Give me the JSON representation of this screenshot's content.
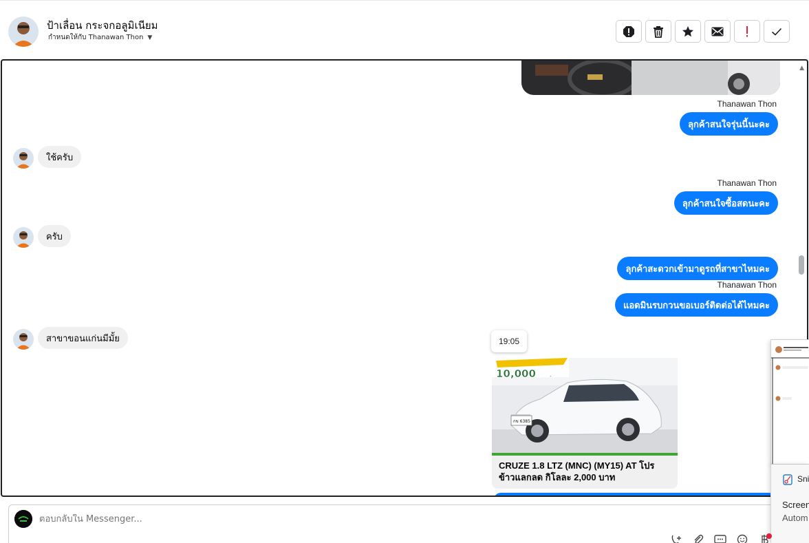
{
  "header": {
    "contact_name": "ป้าเลื่อน กระจกอลูมิเนียม",
    "assigned_label": "กำหนดให้กับ Thanawan Thon",
    "tools": [
      "mark-spam",
      "delete",
      "star",
      "mark-unread",
      "important",
      "done"
    ]
  },
  "conversation": {
    "messages": [
      {
        "type": "outgoing",
        "sender": "Thanawan Thon",
        "text": "ลุกค้าสนใจรุ่นนี้นะคะ"
      },
      {
        "type": "incoming",
        "text": "ใช้ครับ"
      },
      {
        "type": "outgoing",
        "sender": "Thanawan Thon",
        "text": "ลุกค้าสนใจซื้อสดนะคะ"
      },
      {
        "type": "incoming",
        "text": "ครับ"
      },
      {
        "type": "outgoing",
        "text": "ลุกค้าสะดวกเข้ามาดูรถที่สาขาไหมคะ"
      },
      {
        "type": "outgoing",
        "sender": "Thanawan Thon",
        "text": "แอดมินรบกวนขอเบอร์ติดต่อได้ไหมคะ"
      },
      {
        "type": "incoming",
        "text": "สาขาขอนแก่นมีมั้ย"
      }
    ],
    "timestamp": "19:05",
    "card": {
      "banner_text": "10,000บาท",
      "plate_text": "กข 6385",
      "title_line1": "CRUZE 1.8 LTZ (MNC) (MY15) AT โปร",
      "title_line2": "ข้าวแลกลด กิโลละ 2,000 บาท"
    }
  },
  "reply": {
    "placeholder": "ตอบกลับใน Messenger..."
  },
  "snip": {
    "app_name": "Sni",
    "line1": "Screen",
    "line2": "Autom"
  },
  "colors": {
    "outgoing_bubble": "#0a7cff",
    "incoming_bubble": "#f0f0f0",
    "border": "#1c1e21",
    "notification_dot": "#e41e3f"
  }
}
